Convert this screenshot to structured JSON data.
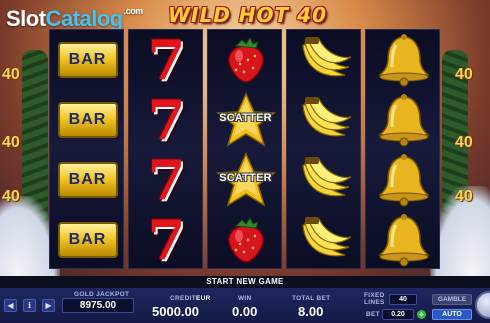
{
  "branding": {
    "site_logo_main": "Slot",
    "site_logo_accent": "Catalog",
    "site_logo_suffix": ".com",
    "game_title": "WILD HOT 40"
  },
  "side_numbers": [
    "40",
    "40",
    "40",
    "40",
    "40",
    "40"
  ],
  "reels": [
    [
      "BAR",
      "BAR",
      "BAR",
      "BAR"
    ],
    [
      "7",
      "7",
      "7",
      "7"
    ],
    [
      "strawberry",
      "SCATTER",
      "SCATTER",
      "strawberry"
    ],
    [
      "banana",
      "banana",
      "banana",
      "banana"
    ],
    [
      "bell",
      "bell",
      "bell",
      "bell"
    ]
  ],
  "scatter_label": "SCATTER",
  "status": {
    "message": "START NEW GAME"
  },
  "panel": {
    "gold_jackpot_label": "GOLD JACKPOT",
    "gold_jackpot_value": "8975.00",
    "credit_label": "CREDIT",
    "credit_currency": "EUR",
    "credit_value": "5000.00",
    "win_label": "WIN",
    "win_value": "0.00",
    "total_bet_label": "TOTAL BET",
    "total_bet_value": "8.00",
    "fixed_lines_label_1": "FIXED",
    "fixed_lines_label_2": "LINES",
    "fixed_lines_value": "40",
    "bet_label": "BET",
    "bet_value": "0.20",
    "gamble_label": "GAMBLE",
    "auto_label": "AUTO",
    "left_buttons": [
      "◀",
      "ℹ",
      "▶"
    ]
  },
  "colors": {
    "reel_bg": "#0b0d24",
    "panel_bg": "#1f2760",
    "title_gold": "#ffd23a",
    "seven_red": "#e2141c"
  }
}
